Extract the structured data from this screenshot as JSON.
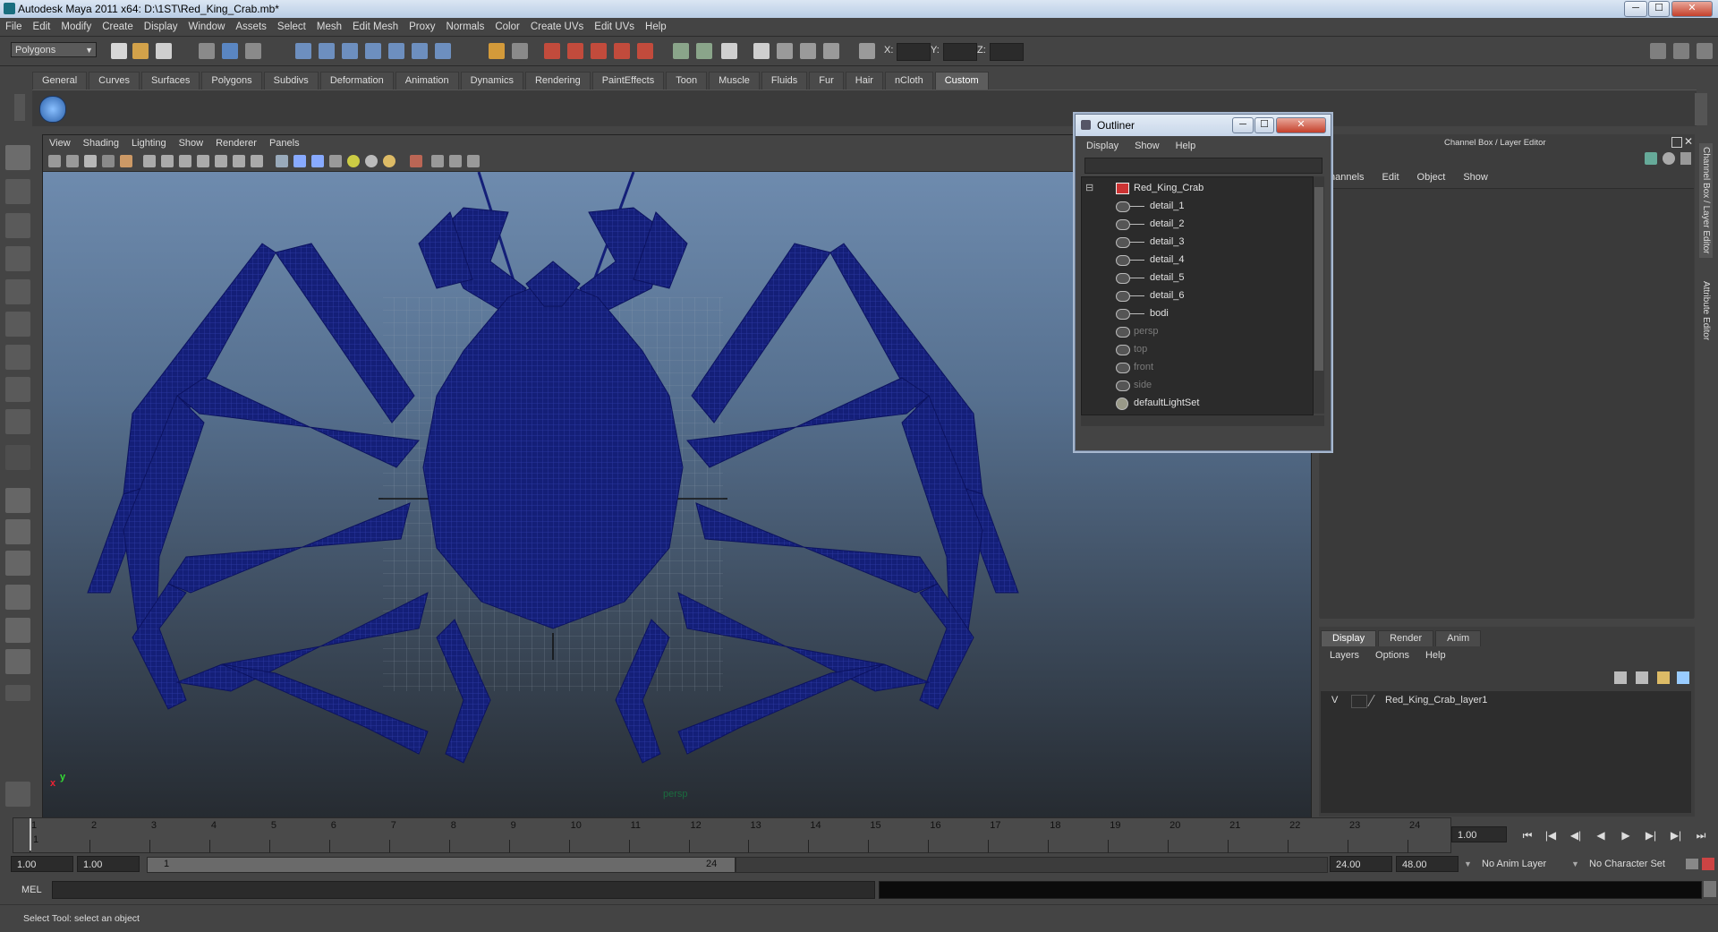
{
  "window": {
    "title": "Autodesk Maya 2011 x64: D:\\1ST\\Red_King_Crab.mb*",
    "minimize": "─",
    "maximize": "☐",
    "close": "✕"
  },
  "menubar": [
    "File",
    "Edit",
    "Modify",
    "Create",
    "Display",
    "Window",
    "Assets",
    "Select",
    "Mesh",
    "Edit Mesh",
    "Proxy",
    "Normals",
    "Color",
    "Create UVs",
    "Edit UVs",
    "Help"
  ],
  "statusline": {
    "mode": "Polygons",
    "x_label": "X:",
    "y_label": "Y:",
    "z_label": "Z:"
  },
  "shelf": {
    "tabs": [
      "General",
      "Curves",
      "Surfaces",
      "Polygons",
      "Subdivs",
      "Deformation",
      "Animation",
      "Dynamics",
      "Rendering",
      "PaintEffects",
      "Toon",
      "Muscle",
      "Fluids",
      "Fur",
      "Hair",
      "nCloth",
      "Custom"
    ],
    "active_tab": "Custom"
  },
  "viewport": {
    "menu": [
      "View",
      "Shading",
      "Lighting",
      "Show",
      "Renderer",
      "Panels"
    ],
    "camera_label": "persp",
    "axis_x": "x",
    "axis_y": "y",
    "mesh_color": "#141f78"
  },
  "outliner": {
    "title": "Outliner",
    "menu": [
      "Display",
      "Show",
      "Help"
    ],
    "items": [
      {
        "label": "Red_King_Crab",
        "dim": false
      },
      {
        "label": "detail_1",
        "dim": false
      },
      {
        "label": "detail_2",
        "dim": false
      },
      {
        "label": "detail_3",
        "dim": false
      },
      {
        "label": "detail_4",
        "dim": false
      },
      {
        "label": "detail_5",
        "dim": false
      },
      {
        "label": "detail_6",
        "dim": false
      },
      {
        "label": "bodi",
        "dim": false
      },
      {
        "label": "persp",
        "dim": true
      },
      {
        "label": "top",
        "dim": true
      },
      {
        "label": "front",
        "dim": true
      },
      {
        "label": "side",
        "dim": true
      },
      {
        "label": "defaultLightSet",
        "dim": false
      }
    ]
  },
  "channelbox": {
    "header": "Channel Box / Layer Editor",
    "menu": [
      "hannels",
      "Edit",
      "Object",
      "Show"
    ],
    "side_tabs": [
      "Channel Box / Layer Editor",
      "Attribute Editor"
    ]
  },
  "layers": {
    "tabs": [
      "Display",
      "Render",
      "Anim"
    ],
    "active_tab": "Display",
    "menu": [
      "Layers",
      "Options",
      "Help"
    ],
    "items": [
      {
        "visible": "V",
        "name": "Red_King_Crab_layer1"
      }
    ]
  },
  "timeslider": {
    "start": 1,
    "end": 24,
    "current_frame": "1",
    "current_field": "1.00"
  },
  "range": {
    "start_time": "1.00",
    "playback_start": "1.00",
    "range_start_label": "1",
    "range_end_label": "24",
    "playback_end": "24.00",
    "end_time": "48.00",
    "anim_layer": "No Anim Layer",
    "character_set": "No Character Set"
  },
  "cmdline": {
    "label": "MEL"
  },
  "helpline": {
    "text": "Select Tool: select an object"
  }
}
